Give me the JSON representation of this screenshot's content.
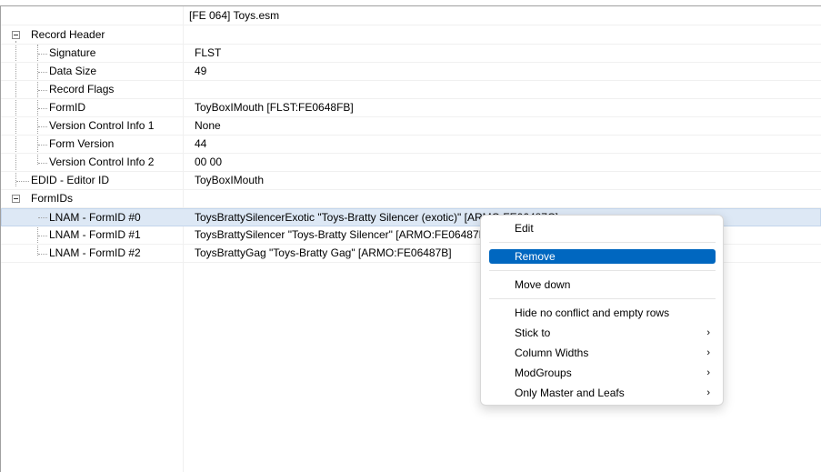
{
  "header": {
    "file": "[FE 064] Toys.esm"
  },
  "rows": [
    {
      "name": "Record Header",
      "value": ""
    },
    {
      "name": "Signature",
      "value": "FLST"
    },
    {
      "name": "Data Size",
      "value": "49"
    },
    {
      "name": "Record Flags",
      "value": ""
    },
    {
      "name": "FormID",
      "value": "ToyBoxIMouth [FLST:FE0648FB]"
    },
    {
      "name": "Version Control Info 1",
      "value": "None"
    },
    {
      "name": "Form Version",
      "value": "44"
    },
    {
      "name": "Version Control Info 2",
      "value": "00 00"
    },
    {
      "name": "EDID - Editor ID",
      "value": "ToyBoxIMouth"
    },
    {
      "name": "FormIDs",
      "value": ""
    },
    {
      "name": "LNAM - FormID #0",
      "value": "ToysBrattySilencerExotic \"Toys-Bratty Silencer (exotic)\" [ARMO:FE06487C]"
    },
    {
      "name": "LNAM - FormID #1",
      "value": "ToysBrattySilencer \"Toys-Bratty Silencer\" [ARMO:FE06487D]"
    },
    {
      "name": "LNAM - FormID #2",
      "value": "ToysBrattyGag \"Toys-Bratty Gag\" [ARMO:FE06487B]"
    }
  ],
  "menu": {
    "edit": "Edit",
    "remove": "Remove",
    "move_down": "Move down",
    "hide_no_conflict": "Hide no conflict and empty rows",
    "stick_to": "Stick to",
    "column_widths": "Column Widths",
    "mod_groups": "ModGroups",
    "only_master_leafs": "Only Master and Leafs",
    "submenu_arrow": "›"
  },
  "icons": {
    "expander": "collapse-box-icon",
    "submenu": "chevron-right-icon"
  },
  "colors": {
    "selection": "#dde8f5",
    "menu_highlight": "#0067c0"
  }
}
